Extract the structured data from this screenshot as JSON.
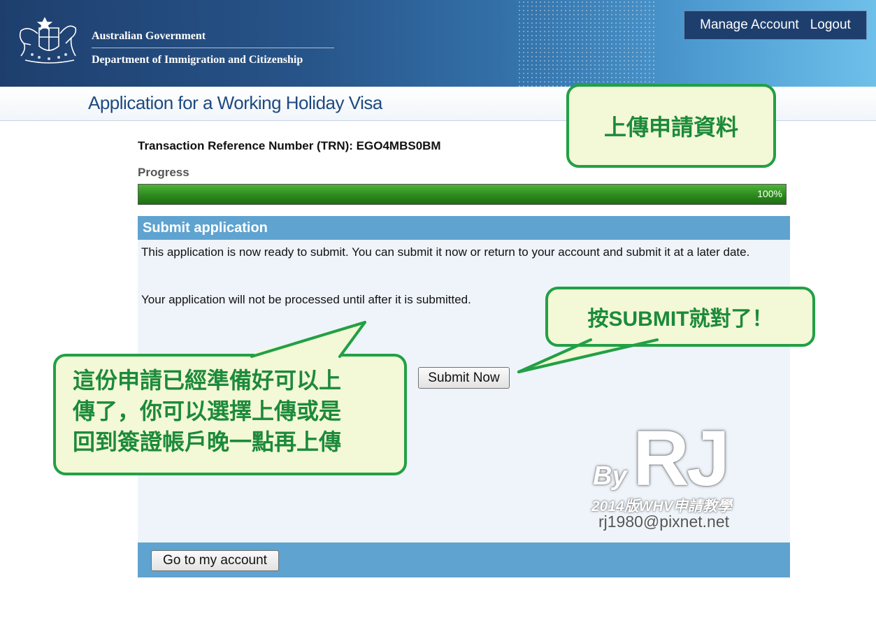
{
  "header": {
    "government": "Australian Government",
    "department": "Department of Immigration and Citizenship",
    "manage_account": "Manage Account",
    "logout": "Logout"
  },
  "page": {
    "title": "Application for a Working Holiday Visa",
    "trn": "Transaction Reference Number (TRN): EGO4MBS0BM"
  },
  "progress": {
    "label": "Progress",
    "percent_text": "100%",
    "value": 1.0,
    "color": "#2b8a1c"
  },
  "panel": {
    "title": "Submit application",
    "message1": "This application is now ready to submit. You can submit it now or return to your account and submit it at a later date.",
    "message2": "Your application will not be processed until after it is submitted.",
    "submit_button": "Submit Now",
    "account_button": "Go to my account"
  },
  "annotations": {
    "top": "上傳申請資料",
    "right": "按SUBMIT就對了！",
    "left_line1": "這份申請已經準備好可以上",
    "left_line2": "傳了，你可以選擇上傳或是",
    "left_line3": "回到簽證帳戶晚一點再上傳"
  },
  "watermark": {
    "by": "By",
    "rj": "RJ",
    "line2": "2014版WHV申請教學",
    "email": "rj1980@pixnet.net"
  },
  "colors": {
    "banner": "#275489",
    "panel_header": "#5fa3d0",
    "callout_border": "#22a045",
    "callout_text": "#1c8a3a"
  }
}
